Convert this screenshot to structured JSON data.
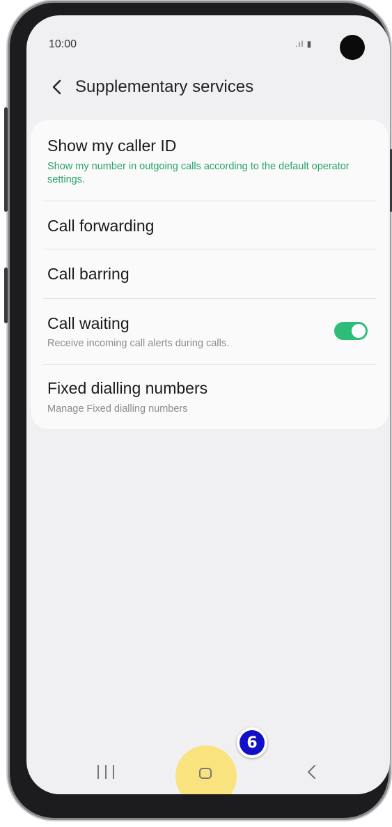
{
  "status_bar": {
    "time": "10:00",
    "icons": ".ıl ▮"
  },
  "app_bar": {
    "title": "Supplementary services"
  },
  "settings": {
    "items": [
      {
        "title": "Show my caller ID",
        "subtitle": "Show my number in outgoing calls according to the default operator settings."
      },
      {
        "title": "Call forwarding"
      },
      {
        "title": "Call barring"
      },
      {
        "title": "Call waiting",
        "subtitle": "Receive incoming call alerts during calls.",
        "toggle_on": true
      },
      {
        "title": "Fixed dialling numbers",
        "subtitle": "Manage Fixed dialling numbers"
      }
    ]
  },
  "tutorial": {
    "step": "6"
  },
  "colors": {
    "accent_green": "#27a36a",
    "toggle_on": "#2ebd77",
    "highlight": "#fcde50",
    "badge_blue": "#1010c8"
  }
}
